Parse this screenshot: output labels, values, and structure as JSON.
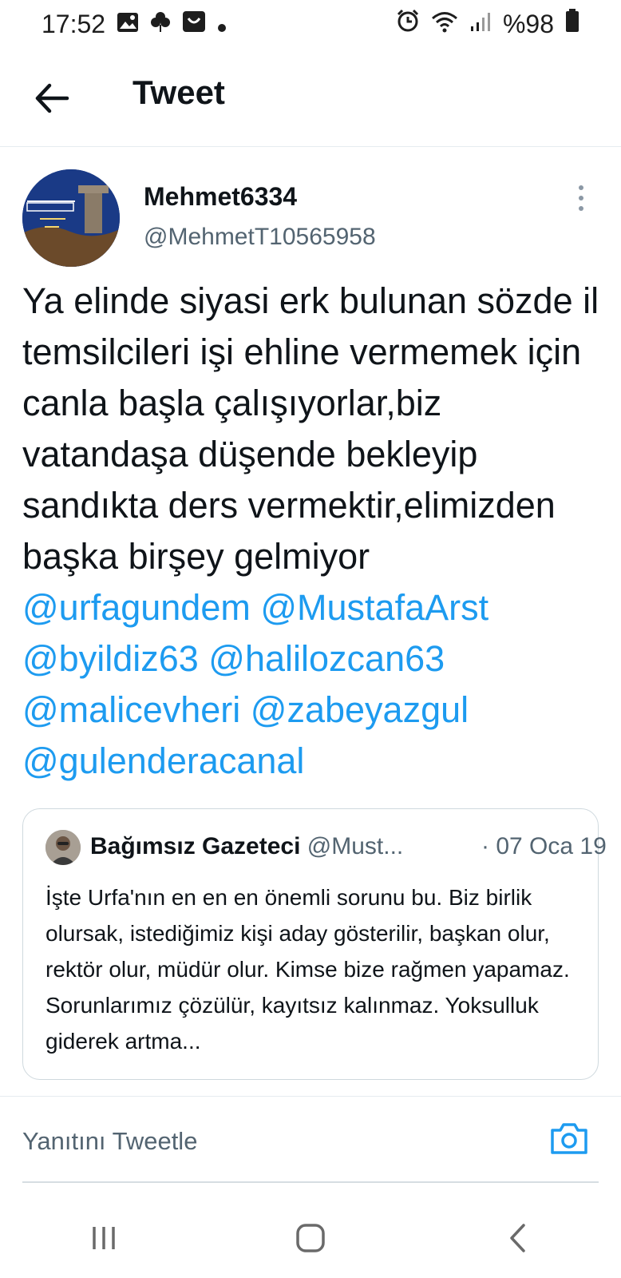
{
  "status_bar": {
    "time": "17:52",
    "battery": "%98",
    "left_icons": [
      "image-icon",
      "flower-icon",
      "inbox-icon",
      "dot-icon"
    ],
    "right_icons": [
      "alarm-icon",
      "wifi-icon",
      "signal-icon",
      "battery-icon"
    ]
  },
  "header": {
    "title": "Tweet"
  },
  "tweet": {
    "display_name": "Mehmet6334",
    "handle": "@MehmetT10565958",
    "text": "Ya elinde siyasi erk bulunan sözde il temsilcileri işi ehline vermemek için canla başla çalışıyorlar,biz vatandaşa düşende bekleyip sandıkta ders vermektir,elimizden başka birşey gelmiyor",
    "mentions": [
      "@urfagundem",
      "@MustafaArst",
      "@byildiz63",
      "@halilozcan63",
      "@malicevheri",
      "@zabeyazgul",
      "@gulenderacanal"
    ]
  },
  "quote": {
    "name": "Bağımsız Gazeteci",
    "handle": "@Must...",
    "date": "· 07 Oca 19",
    "text": "İşte Urfa'nın en en en önemli sorunu bu. Biz birlik olursak, istediğimiz kişi aday gösterilir, başkan olur, rektör olur, müdür olur. Kimse bize rağmen yapamaz. Sorunlarımız çözülür, kayıtsız kalınmaz. Yoksulluk giderek artma..."
  },
  "reply": {
    "placeholder": "Yanıtını Tweetle"
  },
  "colors": {
    "accent": "#1d9bf0",
    "text": "#0f1419",
    "secondary": "#536471"
  }
}
